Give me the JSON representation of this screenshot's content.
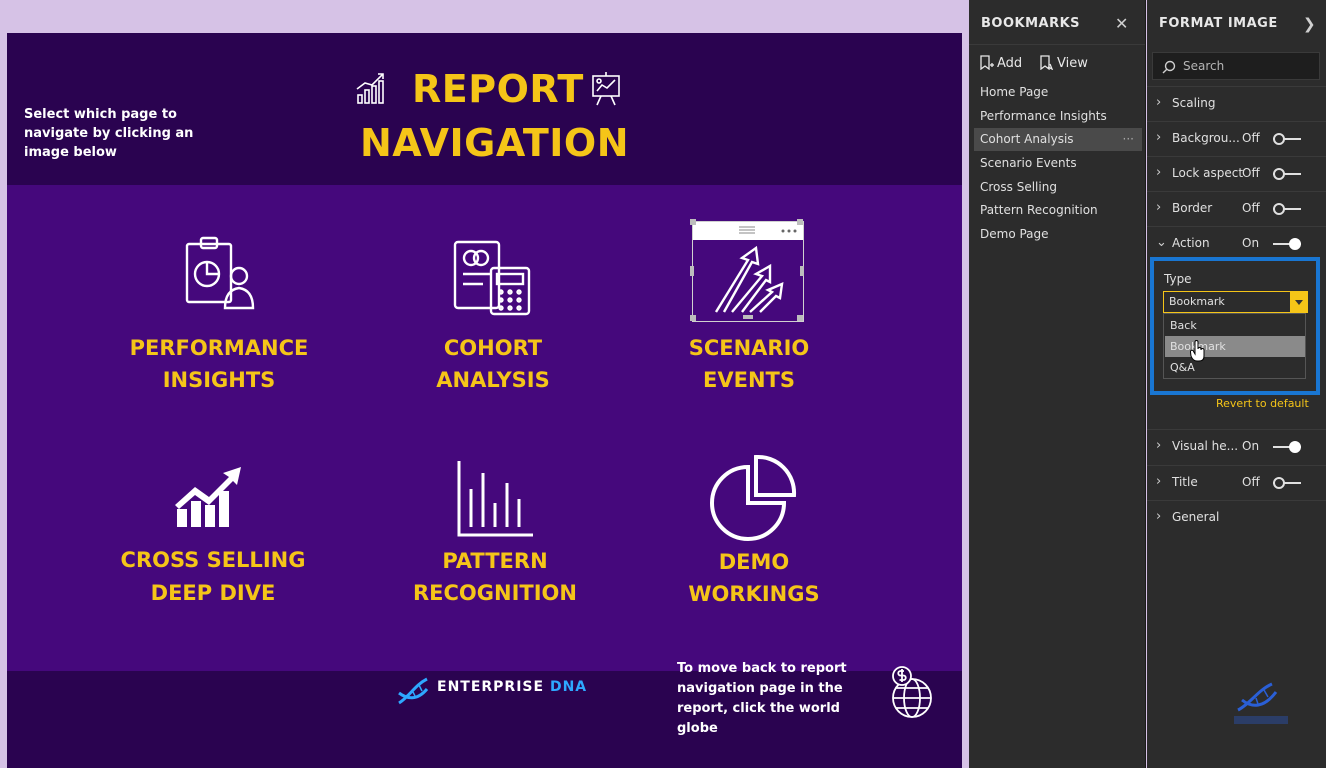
{
  "report": {
    "instruction": "Select which page to navigate by clicking an image below",
    "title_line1": "REPORT",
    "title_line2": "NAVIGATION",
    "tiles": [
      {
        "line1": "PERFORMANCE",
        "line2": "INSIGHTS",
        "icon": "clipboard-chart-icon"
      },
      {
        "line1": "COHORT",
        "line2": "ANALYSIS",
        "icon": "calculator-document-icon"
      },
      {
        "line1": "SCENARIO",
        "line2": "EVENTS",
        "icon": "growth-arrows-icon"
      },
      {
        "line1": "CROSS SELLING",
        "line2": "DEEP DIVE",
        "icon": "trend-up-bars-icon"
      },
      {
        "line1": "PATTERN",
        "line2": "RECOGNITION",
        "icon": "bar-chart-icon"
      },
      {
        "line1": "DEMO",
        "line2": "WORKINGS",
        "icon": "pie-chart-icon"
      }
    ],
    "footer": {
      "brand_main": "ENTERPRISE ",
      "brand_accent": "DNA",
      "text": "To move back to report navigation page in the report, click the world globe"
    }
  },
  "bookmarks": {
    "title": "BOOKMARKS",
    "add_label": "Add",
    "view_label": "View",
    "items": [
      "Home Page",
      "Performance Insights",
      "Cohort Analysis",
      "Scenario Events",
      "Cross Selling",
      "Pattern Recognition",
      "Demo Page"
    ],
    "active_index": 2
  },
  "format": {
    "title": "FORMAT IMAGE",
    "search_placeholder": "Search",
    "sections": {
      "scaling": {
        "label": "Scaling"
      },
      "background": {
        "label": "Backgrou...",
        "state": "Off"
      },
      "lock": {
        "label": "Lock aspect",
        "state": "Off"
      },
      "border": {
        "label": "Border",
        "state": "Off"
      },
      "action": {
        "label": "Action",
        "state": "On"
      },
      "visual_header": {
        "label": "Visual he...",
        "state": "On"
      },
      "title": {
        "label": "Title",
        "state": "Off"
      },
      "general": {
        "label": "General"
      }
    },
    "type_label": "Type",
    "type_value": "Bookmark",
    "options": [
      "Back",
      "Bookmark",
      "Q&A"
    ],
    "revert": "Revert to default"
  },
  "colors": {
    "accent_yellow": "#f5c518",
    "report_bg": "#45087c",
    "panel_bg": "#2c2c2c",
    "highlight_blue": "#1976d2"
  }
}
